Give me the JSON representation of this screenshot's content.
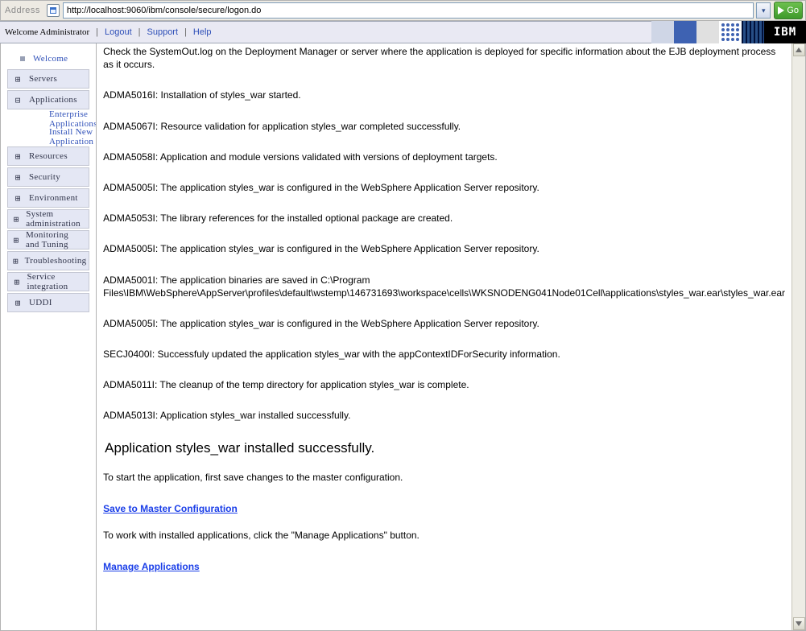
{
  "address": {
    "label": "Address",
    "url": "http://localhost:9060/ibm/console/secure/logon.do",
    "go": "Go"
  },
  "header": {
    "welcome": "Welcome Administrator",
    "logout": "Logout",
    "support": "Support",
    "help": "Help",
    "ibm": "IBM"
  },
  "nav": {
    "welcome": "Welcome",
    "servers": "Servers",
    "applications": "Applications",
    "app_sub_enterprise": "Enterprise Applications",
    "app_sub_install": "Install New Application",
    "resources": "Resources",
    "security": "Security",
    "environment": "Environment",
    "sysadmin": "System administration",
    "monitoring": "Monitoring and Tuning",
    "troubleshooting": "Troubleshooting",
    "service_integration": "Service integration",
    "uddi": "UDDI"
  },
  "log": {
    "m0": "Check the SystemOut.log on the Deployment Manager or server where the application is deployed for specific information about the EJB deployment process as it occurs.",
    "m1": "ADMA5016I: Installation of styles_war started.",
    "m2": "ADMA5067I: Resource validation for application styles_war completed successfully.",
    "m3": "ADMA5058I: Application and module versions validated with versions of deployment targets.",
    "m4": "ADMA5005I: The application styles_war is configured in the WebSphere Application Server repository.",
    "m5": "ADMA5053I: The library references for the installed optional package are created.",
    "m6": "ADMA5005I: The application styles_war is configured in the WebSphere Application Server repository.",
    "m7": "ADMA5001I: The application binaries are saved in C:\\Program Files\\IBM\\WebSphere\\AppServer\\profiles\\default\\wstemp\\146731693\\workspace\\cells\\WKSNODENG041Node01Cell\\applications\\styles_war.ear\\styles_war.ear",
    "m8": "ADMA5005I: The application styles_war is configured in the WebSphere Application Server repository.",
    "m9": "SECJ0400I: Successfuly updated the application styles_war with the appContextIDForSecurity information.",
    "m10": "ADMA5011I: The cleanup of the temp directory for application styles_war is complete.",
    "m11": "ADMA5013I: Application styles_war installed successfully.",
    "heading": "Application styles_war installed successfully.",
    "hint1": "To start the application, first save changes to the master configuration.",
    "link1": "Save to Master Configuration",
    "hint2": "To work with installed applications, click the \"Manage Applications\" button.",
    "link2": "Manage Applications"
  }
}
